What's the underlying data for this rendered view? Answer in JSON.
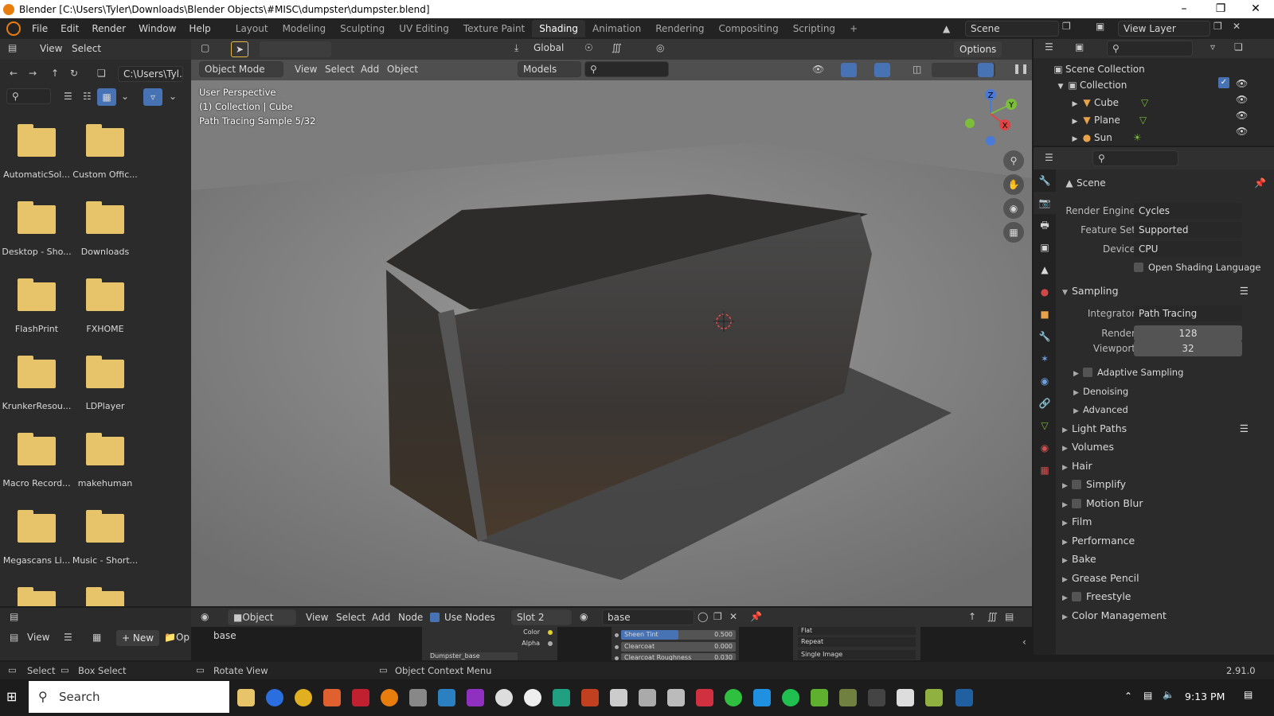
{
  "window": {
    "title": "Blender [C:\\Users\\Tyler\\Downloads\\Blender Objects\\#MISC\\dumpster\\dumpster.blend]"
  },
  "menubar": {
    "menus": [
      "File",
      "Edit",
      "Render",
      "Window",
      "Help"
    ],
    "workspaces": [
      "Layout",
      "Modeling",
      "Sculpting",
      "UV Editing",
      "Texture Paint",
      "Shading",
      "Animation",
      "Rendering",
      "Compositing",
      "Scripting"
    ],
    "active_workspace": "Shading",
    "add_tab": "+",
    "scene": "Scene",
    "view_layer": "View Layer"
  },
  "filebrowser": {
    "menu_view": "View",
    "menu_select": "Select",
    "path": "C:\\Users\\Tyl...",
    "folders": [
      "AutomaticSol...",
      "Custom Offic...",
      "Desktop - Sho...",
      "Downloads",
      "FlashPrint",
      "FXHOME",
      "KrunkerResou...",
      "LDPlayer",
      "Macro Record...",
      "makehuman",
      "Megascans Li...",
      "Music - Short..."
    ]
  },
  "viewport": {
    "options": "Options",
    "orientation": "Global",
    "mode": "Object Mode",
    "menus": [
      "View",
      "Select",
      "Add",
      "Object"
    ],
    "collection_filter": "Models",
    "overlay_line1": "User Perspective",
    "overlay_line2": "(1) Collection | Cube",
    "overlay_line3": "Path Tracing Sample 5/32",
    "gizmo_z": "Z",
    "gizmo_y": "Y",
    "gizmo_x": "X"
  },
  "outliner": {
    "scene_collection": "Scene Collection",
    "collection": "Collection",
    "objects": [
      "Cube",
      "Plane",
      "Sun"
    ]
  },
  "properties": {
    "context": "Scene",
    "render_engine_label": "Render Engine",
    "render_engine": "Cycles",
    "feature_set_label": "Feature Set",
    "feature_set": "Supported",
    "device_label": "Device",
    "device": "CPU",
    "osl": "Open Shading Language",
    "sampling": "Sampling",
    "integrator_label": "Integrator",
    "integrator": "Path Tracing",
    "render_label": "Render",
    "render_samples": "128",
    "viewport_label": "Viewport",
    "viewport_samples": "32",
    "sub_adaptive": "Adaptive Sampling",
    "sub_denoising": "Denoising",
    "sub_advanced": "Advanced",
    "sections": [
      "Light Paths",
      "Volumes",
      "Hair",
      "Simplify",
      "Motion Blur",
      "Film",
      "Performance",
      "Bake",
      "Grease Pencil",
      "Freestyle",
      "Color Management"
    ]
  },
  "nodeeditor": {
    "object_type": "Object",
    "menus": [
      "View",
      "Select",
      "Add",
      "Node"
    ],
    "use_nodes": "Use Nodes",
    "slot": "Slot 2",
    "material": "base",
    "left_view": "View",
    "left_new": "New",
    "left_op": "Op",
    "node_name": "base",
    "socket_color": "Color",
    "socket_alpha": "Alpha",
    "node_dumpster": "Dumpster_base",
    "sheen_tint_label": "Sheen Tint",
    "sheen_tint_value": "0.500",
    "clearcoat_label": "Clearcoat",
    "clearcoat_value": "0.000",
    "clearcoat_rough_label": "Clearcoat Roughness",
    "clearcoat_rough_value": "0.030",
    "img_opt1": "Flat",
    "img_opt2": "Repeat",
    "img_opt3": "Single Image"
  },
  "statusbar": {
    "select": "Select",
    "box_select": "Box Select",
    "rotate_view": "Rotate View",
    "context_menu": "Object Context Menu",
    "version": "2.91.0"
  },
  "taskbar": {
    "search": "Search",
    "time": "9:13 PM"
  },
  "colors": {
    "accent": "#4772b3",
    "blender_orange": "#e87d0d",
    "folder": "#e7c46a"
  }
}
